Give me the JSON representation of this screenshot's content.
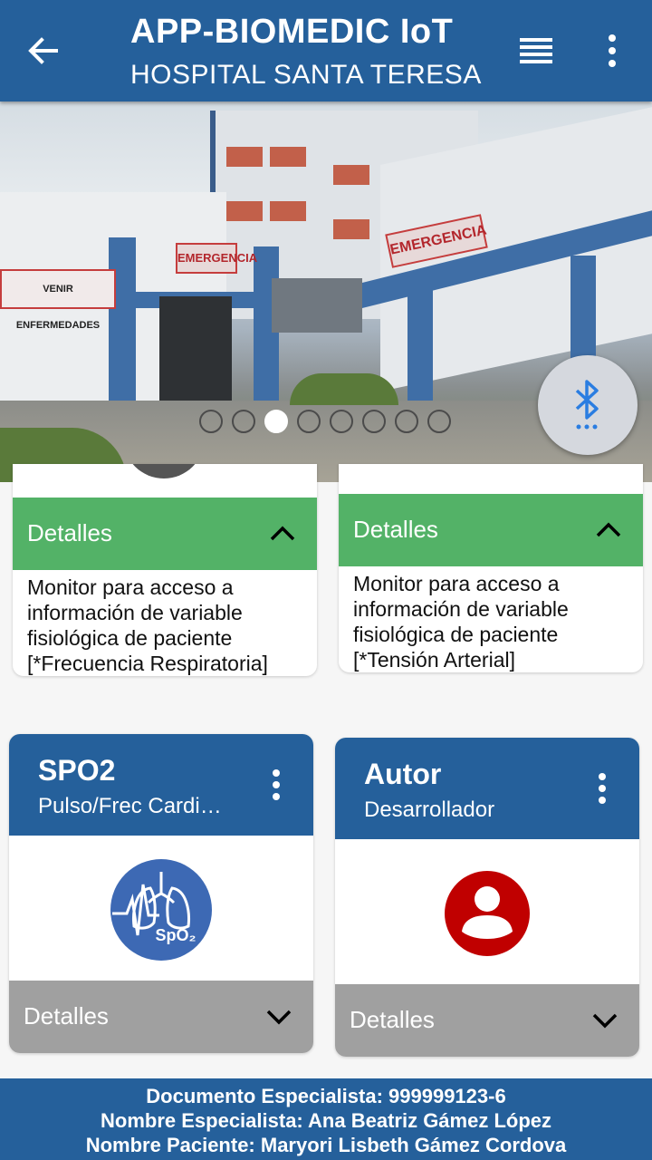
{
  "appbar": {
    "title": "APP-BIOMEDIC IoT",
    "subtitle": "HOSPITAL SANTA TERESA"
  },
  "banner": {
    "signs": [
      "EMERGENCIA",
      "EMERGENCIA"
    ],
    "left_banner": "VENIR ENFERMEDADES",
    "carousel": {
      "count": 8,
      "active_index": 2
    }
  },
  "cards_top": [
    {
      "detail_label": "Detalles",
      "description": "Monitor para acceso a información de variable fisiológica de paciente [*Frecuencia Respiratoria]"
    },
    {
      "detail_label": "Detalles",
      "description": "Monitor para acceso a información de variable fisiológica de paciente [*Tensión Arterial]"
    }
  ],
  "cards_bottom": [
    {
      "title": "SPO2",
      "subtitle": "Pulso/Frec Cardi…",
      "icon": "spo2-lungs-icon",
      "icon_text": "SpO₂",
      "detail_label": "Detalles"
    },
    {
      "title": "Autor",
      "subtitle": "Desarrollador",
      "icon": "user-avatar-icon",
      "detail_label": "Detalles"
    }
  ],
  "footer": {
    "line1": "Documento Especialista: 999999123-6",
    "line2": "Nombre Especialista: Ana Beatriz Gámez López",
    "line3": "Nombre Paciente: Maryori Lisbeth Gámez Cordova"
  },
  "colors": {
    "primary": "#25609b",
    "green": "#53b267",
    "gray": "#a0a0a0",
    "avatar_red": "#c00000",
    "spo2_blue": "#3d69b4"
  }
}
